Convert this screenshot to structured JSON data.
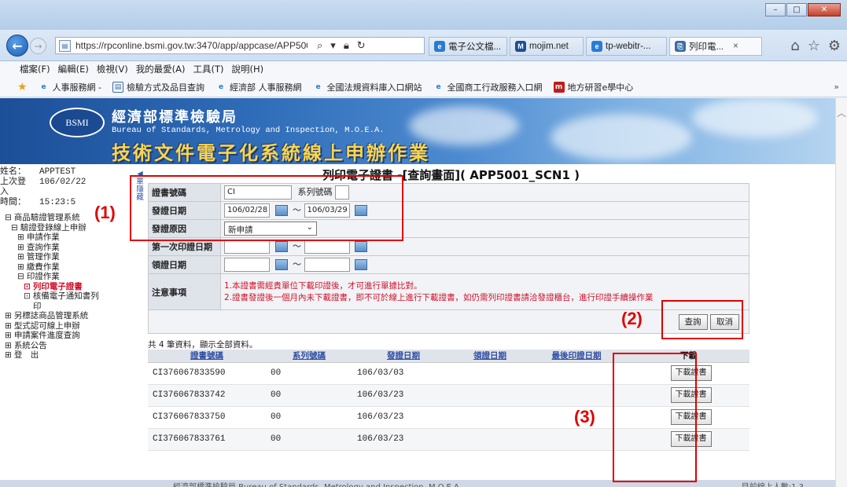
{
  "browser": {
    "url": "https://rpconline.bsmi.gov.tw:3470/app/appcase/APP500",
    "tabs": [
      {
        "label": "電子公文檔...",
        "icon_color": "#2a7bd6",
        "icon": "e"
      },
      {
        "label": "mojim.net",
        "icon_color": "#1c4f98",
        "icon": "M"
      },
      {
        "label": "tp-webitr-...",
        "icon_color": "#2a7bd6",
        "icon": "e"
      },
      {
        "label": "列印電...",
        "icon_color": "#3a6ea5",
        "icon": "⎘",
        "close": "×"
      }
    ],
    "menu": [
      "檔案(F)",
      "編輯(E)",
      "檢視(V)",
      "我的最愛(A)",
      "工具(T)",
      "說明(H)"
    ],
    "favorites": [
      {
        "label": "人事服務網 -",
        "icon_color": "#2a7bd6"
      },
      {
        "label": "檢驗方式及品目查詢",
        "icon_color": "#3a6ea5"
      },
      {
        "label": "經濟部 人事服務網",
        "icon_color": "#2a7bd6"
      },
      {
        "label": "全國法規資料庫入口網站",
        "icon_color": "#2a7bd6"
      },
      {
        "label": "全國商工行政服務入口網",
        "icon_color": "#2a7bd6"
      },
      {
        "label": "地方研習e學中心",
        "icon_color": "#c21b1b"
      }
    ],
    "more": "»",
    "window_buttons": [
      "–",
      "□",
      "✕"
    ]
  },
  "banner": {
    "logo_text": "BSMI",
    "org_zh": "經濟部標準檢驗局",
    "org_en": "Bureau of Standards, Metrology and Inspection, M.O.E.A.",
    "system_title": "技術文件電子化系統線上申辦作業"
  },
  "sidebar": {
    "name_label": "姓名：",
    "name_value": "APPTEST",
    "last_login_label": "上次登入",
    "last_login_date": "106/02/22",
    "time_label": "時間：",
    "time_value": "15:23:5",
    "tree": [
      {
        "label": "商品驗證管理系統",
        "level": 0,
        "sign": "⊟"
      },
      {
        "label": "驗證登錄線上申辦",
        "level": 1,
        "sign": "⊟"
      },
      {
        "label": "申請作業",
        "level": 2,
        "sign": "⊞"
      },
      {
        "label": "查詢作業",
        "level": 2,
        "sign": "⊞"
      },
      {
        "label": "管理作業",
        "level": 2,
        "sign": "⊞"
      },
      {
        "label": "繳費作業",
        "level": 2,
        "sign": "⊞"
      },
      {
        "label": "印證作業",
        "level": 2,
        "sign": "⊟"
      },
      {
        "label": "列印電子證書",
        "level": 3,
        "sign": "⊡",
        "active": true
      },
      {
        "label": "核備電子通知書列",
        "level": 3,
        "sign": "⊡"
      },
      {
        "label": "印",
        "level": 3,
        "sign": ""
      },
      {
        "label": "另標誌商品管理系統",
        "level": 0,
        "sign": "⊞"
      },
      {
        "label": "型式認可線上申辦",
        "level": 0,
        "sign": "⊞"
      },
      {
        "label": "申請案件進度查詢",
        "level": 0,
        "sign": "⊞"
      },
      {
        "label": "系統公告",
        "level": 0,
        "sign": "⊞"
      },
      {
        "label": "登　出",
        "level": 0,
        "sign": "⊞"
      }
    ]
  },
  "handle_text": "◀ 單 隱 藏",
  "page_title": "列印電子證書 -[查詢畫面]( APP5001_SCN1 )",
  "form": {
    "cert_no_label": "證書號碼",
    "cert_no_value": "CI",
    "serial_label": "系列號碼",
    "serial_value": "",
    "issue_date_label": "發證日期",
    "issue_date_from": "106/02/28",
    "issue_date_to": "106/03/29",
    "tilde": "～",
    "reason_label": "發證原因",
    "reason_value": "新申請",
    "first_print_label": "第一次印證日期",
    "collect_label": "領證日期",
    "notes_label": "注意事項",
    "note1": "1.本證書需經貴單位下載印證後，才可進行單據比對。",
    "note2": "2.證書發證後一個月內未下載證書，即不可於線上進行下載證書，如仍需列印證書請洽發證櫃台，進行印證手續操作業",
    "query_button": "查詢",
    "cancel_button": "取消"
  },
  "results": {
    "count_text": "共 4 筆資料，顯示全部資料。",
    "headers": [
      "證書號碼",
      "系列號碼",
      "發證日期",
      "領證日期",
      "最後印證日期",
      "下載"
    ],
    "rows": [
      {
        "cert": "CI376067833590",
        "serial": "00",
        "date": "106/03/03",
        "button": "下載證書"
      },
      {
        "cert": "CI376067833742",
        "serial": "00",
        "date": "106/03/23",
        "button": "下載證書"
      },
      {
        "cert": "CI376067833750",
        "serial": "00",
        "date": "106/03/23",
        "button": "下載證書"
      },
      {
        "cert": "CI376067833761",
        "serial": "00",
        "date": "106/03/23",
        "button": "下載證書"
      }
    ]
  },
  "annotations": [
    "(1)",
    "(2)",
    "(3)"
  ],
  "annotation_color": "#e00000",
  "footer": {
    "left": "經濟部標準檢驗局 Bureau of Standards, Metrology and Inspection, M.O.E.A.",
    "right": "目前線上人數:1 3"
  }
}
